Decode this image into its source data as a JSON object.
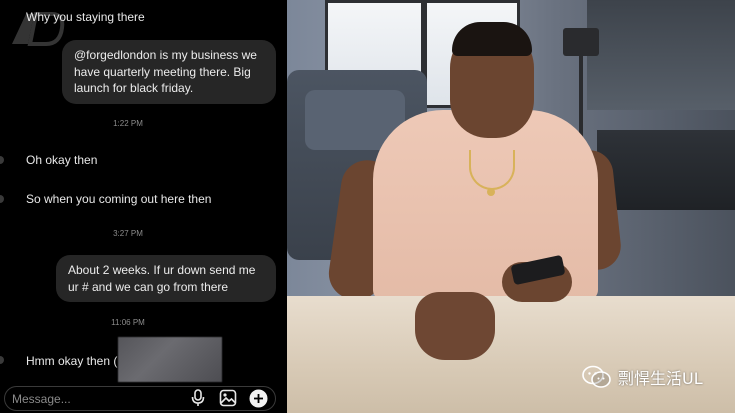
{
  "chat": {
    "messages": [
      {
        "id": "m1",
        "direction": "incoming",
        "text": "Why you staying there"
      },
      {
        "id": "m2",
        "direction": "outgoing",
        "text": "@forgedlondon is my business we have quarterly meeting there. Big launch for black friday."
      },
      {
        "id": "t1",
        "direction": "timestamp",
        "text": "1:22 PM"
      },
      {
        "id": "m3",
        "direction": "incoming",
        "text": "Oh okay then"
      },
      {
        "id": "m4",
        "direction": "incoming",
        "text": "So when you coming out here then"
      },
      {
        "id": "t2",
        "direction": "timestamp",
        "text": "3:27 PM"
      },
      {
        "id": "m5",
        "direction": "outgoing",
        "text": "About 2 weeks. If ur down send me ur # and we can go from there"
      },
      {
        "id": "t3",
        "direction": "timestamp",
        "text": "11:06 PM"
      },
      {
        "id": "m6",
        "direction": "incoming",
        "text": "Hmm okay then ("
      }
    ],
    "composer": {
      "placeholder": "Message...",
      "icons": [
        "microphone-icon",
        "image-icon",
        "add-icon"
      ]
    }
  },
  "overlay": {
    "channel_name": "剽悍生活UL",
    "channel_icon": "wechat-icon"
  },
  "colors": {
    "chat_bg": "#000000",
    "bubble_out": "#262626",
    "text": "#e9e9e9",
    "timestamp": "#8c8c8c"
  }
}
